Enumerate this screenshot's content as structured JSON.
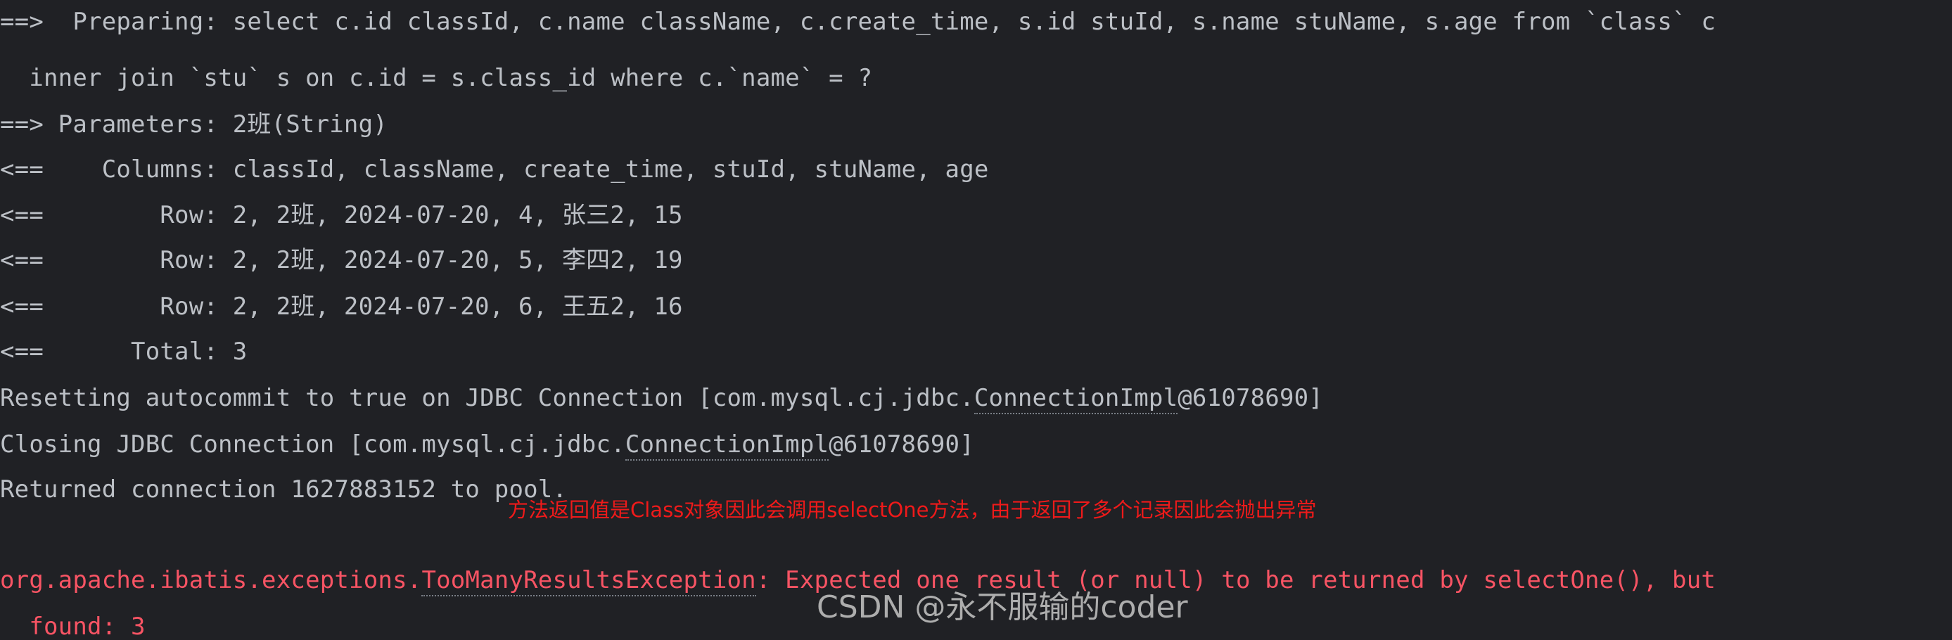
{
  "terminal": {
    "background_color": "#202125",
    "default_text_color": "#c9ccd1",
    "error_text_color": "#f75464",
    "annotation_color": "#ef1a1a",
    "watermark_color": "#b9b9b9",
    "lines": [
      {
        "id": "prepare-line-1",
        "text": "==>  Preparing: select c.id classId, c.name className, c.create_time, s.id stuId, s.name stuName, s.age from `class` c",
        "type": "sql-log"
      },
      {
        "id": "prepare-line-2",
        "text": "  inner join `stu` s on c.id = s.class_id where c.`name` = ?",
        "type": "sql-log"
      },
      {
        "id": "parameters-line",
        "text": "==> Parameters: 2班(String)",
        "type": "sql-log"
      },
      {
        "id": "columns-line",
        "text": "<==    Columns: classId, className, create_time, stuId, stuName, age",
        "type": "sql-log"
      },
      {
        "id": "row-line-1",
        "text": "<==        Row: 2, 2班, 2024-07-20, 4, 张三2, 15",
        "type": "sql-log"
      },
      {
        "id": "row-line-2",
        "text": "<==        Row: 2, 2班, 2024-07-20, 5, 李四2, 19",
        "type": "sql-log"
      },
      {
        "id": "row-line-3",
        "text": "<==        Row: 2, 2班, 2024-07-20, 6, 王五2, 16",
        "type": "sql-log"
      },
      {
        "id": "total-line",
        "text": "<==      Total: 3",
        "type": "sql-log"
      }
    ],
    "resetting_line": {
      "prefix": "Resetting autocommit to true on JDBC Connection [com.mysql.cj.jdbc.",
      "linked": "ConnectionImpl",
      "suffix": "@61078690]"
    },
    "closing_line": {
      "prefix": "Closing JDBC Connection [com.mysql.cj.jdbc.",
      "linked": "ConnectionImpl",
      "suffix": "@61078690]"
    },
    "returned_line": {
      "text": "Returned connection 1627883152 to pool."
    },
    "exception_line": {
      "prefix": "org.apache.ibatis.exceptions.",
      "linked": "TooManyResultsException",
      "suffix": ": Expected one result (or null) to be returned by selectOne(), but"
    },
    "exception_line_2": {
      "text": "  found: 3"
    }
  },
  "annotation": {
    "text": "方法返回值是Class对象因此会调用selectOne方法，由于返回了多个记录因此会抛出异常"
  },
  "watermark": {
    "text": "CSDN @永不服输的coder"
  }
}
